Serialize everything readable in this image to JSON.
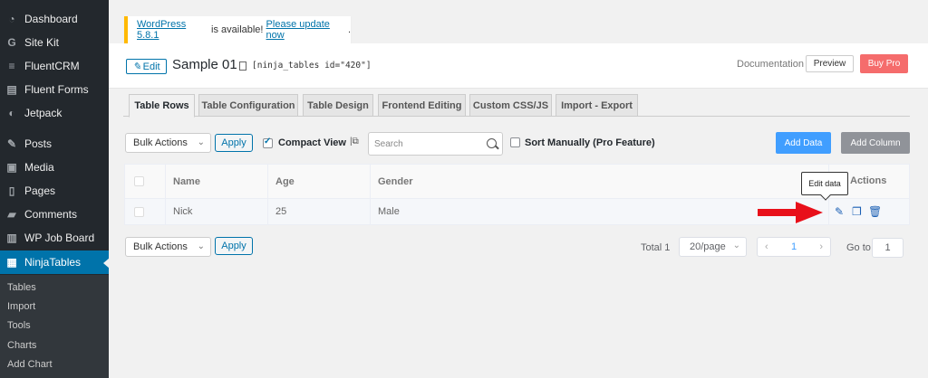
{
  "sidebar": {
    "items": [
      {
        "label": "Dashboard",
        "icon": "dashboard-icon"
      },
      {
        "label": "Site Kit",
        "icon": "sitekit-icon"
      },
      {
        "label": "FluentCRM",
        "icon": "fluentcrm-icon"
      },
      {
        "label": "Fluent Forms",
        "icon": "fluentforms-icon"
      },
      {
        "label": "Jetpack",
        "icon": "jetpack-icon"
      },
      {
        "label": "Posts",
        "icon": "posts-icon"
      },
      {
        "label": "Media",
        "icon": "media-icon"
      },
      {
        "label": "Pages",
        "icon": "pages-icon"
      },
      {
        "label": "Comments",
        "icon": "comments-icon"
      },
      {
        "label": "WP Job Board",
        "icon": "jobboard-icon"
      },
      {
        "label": "NinjaTables",
        "icon": "ninjatables-icon"
      }
    ],
    "submenu": [
      "Tables",
      "Import",
      "Tools",
      "Charts",
      "Add Chart"
    ]
  },
  "notice": {
    "link1": "WordPress 5.8.1",
    "text": " is available! ",
    "link2": "Please update now",
    "end": "."
  },
  "header": {
    "edit_label": "Edit",
    "title": "Sample 01",
    "shortcode": "[ninja_tables id=\"420\"]",
    "documentation": "Documentation",
    "preview": "Preview",
    "buy_pro": "Buy Pro"
  },
  "tabs": [
    {
      "label": "Table Rows",
      "active": true
    },
    {
      "label": "Table Configuration",
      "active": false
    },
    {
      "label": "Table Design",
      "active": false
    },
    {
      "label": "Frontend Editing",
      "active": false
    },
    {
      "label": "Custom CSS/JS",
      "active": false
    },
    {
      "label": "Import - Export",
      "active": false
    }
  ],
  "toolbar": {
    "bulk_actions": "Bulk Actions",
    "apply": "Apply",
    "compact_view": "Compact View",
    "compact_checked": true,
    "search_placeholder": "Search",
    "sort_manually": "Sort Manually (Pro Feature)",
    "add_data": "Add Data",
    "add_column": "Add Column"
  },
  "table": {
    "headers": [
      "Name",
      "Age",
      "Gender",
      "Actions"
    ],
    "rows": [
      {
        "name": "Nick",
        "age": "25",
        "gender": "Male"
      }
    ],
    "tooltip": "Edit data"
  },
  "footer": {
    "bulk_actions": "Bulk Actions",
    "apply": "Apply",
    "total": "Total 1",
    "per_page": "20/page",
    "current_page": "1",
    "goto_label": "Go to",
    "goto_value": "1"
  },
  "colors": {
    "sidebar_bg": "#23282d",
    "active_menu": "#0073aa",
    "add_data": "#409eff",
    "add_column": "#909399",
    "buy_pro": "#f56c6c",
    "arrow": "#e8101a",
    "action_icons": "#1a5fb4"
  }
}
